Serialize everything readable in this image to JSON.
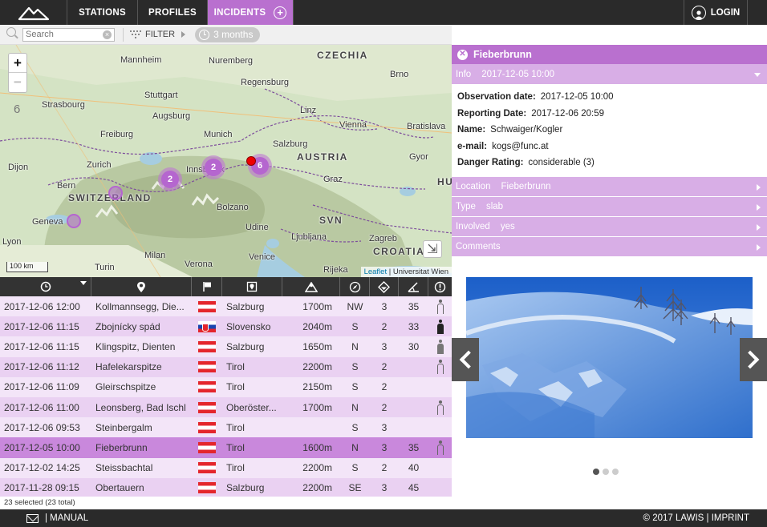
{
  "nav": {
    "tabs": [
      {
        "label": "STATIONS",
        "active": false
      },
      {
        "label": "PROFILES",
        "active": false
      },
      {
        "label": "INCIDENTS",
        "active": true
      }
    ],
    "login_label": "LOGIN"
  },
  "toolbar": {
    "search_placeholder": "Search",
    "filter_label": "FILTER",
    "period_label": "3 months"
  },
  "map": {
    "zoom_level": "6",
    "scale_label": "100 km",
    "attribution_link": "Leaflet",
    "attribution_rest": "| Universitat Wien",
    "labels": {
      "czechia": "CZECHIA",
      "austria": "AUSTRIA",
      "switzerland": "SWITZERLAND",
      "croatia": "CROATIA",
      "hu": "HU",
      "svn": "SVN",
      "mannheim": "Mannheim",
      "nuremberg": "Nuremberg",
      "regensburg": "Regensburg",
      "brno": "Brno",
      "strasbourg": "Strasbourg",
      "stuttgart": "Stuttgart",
      "augsburg": "Augsburg",
      "linz": "Linz",
      "vienna": "Vienna",
      "bratislava": "Bratislava",
      "freiburg": "Freiburg",
      "munich": "Munich",
      "salzburg": "Salzburg",
      "gyor": "Gyor",
      "dijon": "Dijon",
      "zurich": "Zurich",
      "innsbruck": "Innsbruck",
      "graz": "Graz",
      "bern": "Bern",
      "bolzano": "Bolzano",
      "geneva": "Geneva",
      "udine": "Udine",
      "ljubljana": "Ljubljana",
      "zagreb": "Zagreb",
      "lyon": "Lyon",
      "milan": "Milan",
      "venice": "Venice",
      "verona": "Verona",
      "turin": "Turin",
      "rijeka": "Rijeka"
    },
    "clusters": [
      "2",
      "2",
      "6"
    ]
  },
  "table": {
    "columns": [
      "clock-icon",
      "location-pin-icon",
      "flag-icon",
      "region-icon",
      "altitude-icon",
      "aspect-icon",
      "danger-icon",
      "slope-icon",
      "involved-icon"
    ],
    "rows": [
      {
        "date": "2017-12-06 12:00",
        "location": "Kollmannsegg, Die...",
        "flag": "at",
        "region": "Salzburg",
        "alt": "1700m",
        "aspect": "NW",
        "danger": "3",
        "slope": "35",
        "person": "outline",
        "sel": false
      },
      {
        "date": "2017-12-06 11:15",
        "location": "Zbojnícky spád",
        "flag": "sk",
        "region": "Slovensko",
        "alt": "2040m",
        "aspect": "S",
        "danger": "2",
        "slope": "33",
        "person": "black",
        "sel": false
      },
      {
        "date": "2017-12-06 11:15",
        "location": "Klingspitz, Dienten",
        "flag": "at",
        "region": "Salzburg",
        "alt": "1650m",
        "aspect": "N",
        "danger": "3",
        "slope": "30",
        "person": "greyfill",
        "sel": false
      },
      {
        "date": "2017-12-06 11:12",
        "location": "Hafelekarspitze",
        "flag": "at",
        "region": "Tirol",
        "alt": "2200m",
        "aspect": "S",
        "danger": "2",
        "slope": "",
        "person": "outline",
        "sel": false
      },
      {
        "date": "2017-12-06 11:09",
        "location": "Gleirschspitze",
        "flag": "at",
        "region": "Tirol",
        "alt": "2150m",
        "aspect": "S",
        "danger": "2",
        "slope": "",
        "person": "",
        "sel": false
      },
      {
        "date": "2017-12-06 11:00",
        "location": "Leonsberg, Bad Ischl",
        "flag": "at",
        "region": "Oberöster...",
        "alt": "1700m",
        "aspect": "N",
        "danger": "2",
        "slope": "",
        "person": "outline",
        "sel": false
      },
      {
        "date": "2017-12-06 09:53",
        "location": "Steinbergalm",
        "flag": "at",
        "region": "Tirol",
        "alt": "",
        "aspect": "S",
        "danger": "3",
        "slope": "",
        "person": "",
        "sel": false
      },
      {
        "date": "2017-12-05 10:00",
        "location": "Fieberbrunn",
        "flag": "at",
        "region": "Tirol",
        "alt": "1600m",
        "aspect": "N",
        "danger": "3",
        "slope": "35",
        "person": "outline",
        "sel": true
      },
      {
        "date": "2017-12-02 14:25",
        "location": "Steissbachtal",
        "flag": "at",
        "region": "Tirol",
        "alt": "2200m",
        "aspect": "S",
        "danger": "2",
        "slope": "40",
        "person": "",
        "sel": false
      },
      {
        "date": "2017-11-28 09:15",
        "location": "Obertauern",
        "flag": "at",
        "region": "Salzburg",
        "alt": "2200m",
        "aspect": "SE",
        "danger": "3",
        "slope": "45",
        "person": "",
        "sel": false
      }
    ],
    "status": "23 selected (23 total)"
  },
  "panel": {
    "title": "Fieberbrunn",
    "info": {
      "label": "Info",
      "value": "2017-12-05 10:00"
    },
    "fields": [
      {
        "key": "Observation date:",
        "value": "2017-12-05 10:00"
      },
      {
        "key": "Reporting Date:",
        "value": "2017-12-06 20:59"
      },
      {
        "key": "Name:",
        "value": "Schwaiger/Kogler"
      },
      {
        "key": "e-mail:",
        "value": "kogs@func.at"
      },
      {
        "key": "Danger Rating:",
        "value": "considerable (3)"
      }
    ],
    "sections": [
      {
        "label": "Location",
        "value": "Fieberbrunn"
      },
      {
        "label": "Type",
        "value": "slab"
      },
      {
        "label": "Involved",
        "value": "yes"
      },
      {
        "label": "Comments",
        "value": ""
      }
    ]
  },
  "footer": {
    "manual_label": "| MANUAL",
    "copyright": "© 2017 LAWIS | IMPRINT"
  },
  "colors": {
    "accent": "#b970cf",
    "accent_light": "#d8aee6",
    "row_odd": "#f3e5f8",
    "row_even": "#ead1f2",
    "row_selected": "#c988dc",
    "dark": "#2a2a2a"
  }
}
